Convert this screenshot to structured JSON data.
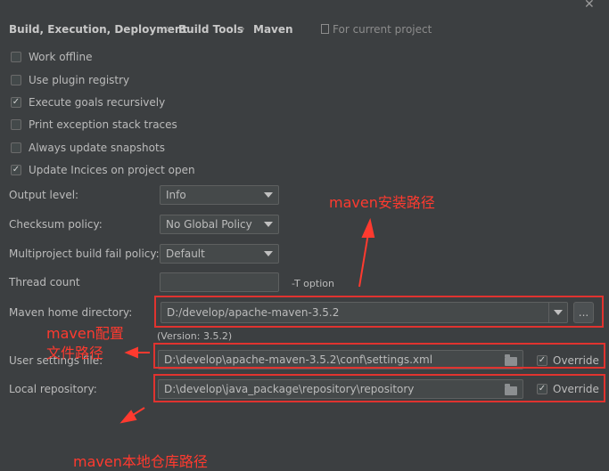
{
  "breadcrumb": {
    "item1": "Build, Execution, Deployment",
    "item2": "Build Tools",
    "item3": "Maven",
    "separator": "›",
    "scope": "For current project"
  },
  "close_symbol": "✕",
  "checkboxes": [
    {
      "label": "Work offline",
      "checked": false
    },
    {
      "label": "Use plugin registry",
      "checked": false
    },
    {
      "label": "Execute goals recursively",
      "checked": true
    },
    {
      "label": "Print exception stack traces",
      "checked": false
    },
    {
      "label": "Always update snapshots",
      "checked": false
    },
    {
      "label": "Update Incices on project open",
      "checked": true
    }
  ],
  "output_level": {
    "label": "Output level:",
    "value": "Info"
  },
  "checksum_policy": {
    "label": "Checksum policy:",
    "value": "No Global Policy"
  },
  "multiproject_policy": {
    "label": "Multiproject build fail policy:",
    "value": "Default"
  },
  "thread_count": {
    "label": "Thread count",
    "value": "",
    "hint": "-T option"
  },
  "maven_home": {
    "label": "Maven home directory:",
    "value": "D:/develop/apache-maven-3.5.2",
    "browse": "...",
    "version": "(Version: 3.5.2)"
  },
  "user_settings": {
    "label": "User settings file:",
    "value": "D:\\develop\\apache-maven-3.5.2\\conf\\settings.xml",
    "override_label": "Override",
    "override_checked": true
  },
  "local_repo": {
    "label": "Local repository:",
    "value": "D:\\develop\\java_package\\repository\\repository",
    "override_label": "Override",
    "override_checked": true
  },
  "annotations": {
    "maven_install": "maven安装路径",
    "maven_config_line1": "maven配置",
    "maven_config_line2": "文件路径",
    "maven_local_repo": "maven本地仓库路径"
  },
  "colors": {
    "background": "#3c3f41",
    "annotation": "#ff3a2f",
    "text": "#bbbbbb"
  }
}
